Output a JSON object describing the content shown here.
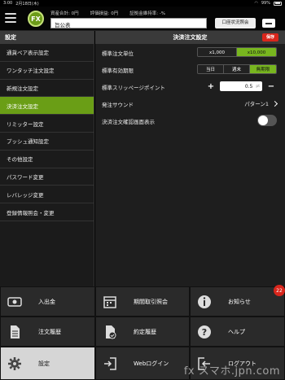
{
  "status_bar": {
    "time": "3:00",
    "date": "2月18日(木)",
    "battery": "99%"
  },
  "header": {
    "logo": "FX",
    "total_assets_label": "資産合計: 0円",
    "valuation_label": "評価損益: 0円",
    "margin_ratio_label": "証拠金維持率: -%",
    "account_name": "旨公表",
    "account_status_button": "口座状況照会"
  },
  "sidebar": {
    "title": "設定",
    "items": [
      {
        "label": "通貨ペア表示設定"
      },
      {
        "label": "ワンタッチ注文設定"
      },
      {
        "label": "新規注文設定"
      },
      {
        "label": "決済注文設定"
      },
      {
        "label": "リミッター設定"
      },
      {
        "label": "プッシュ通知設定"
      },
      {
        "label": "その他設定"
      },
      {
        "label": "パスワード変更"
      },
      {
        "label": "レバレッジ変更"
      },
      {
        "label": "登録情報照会・変更"
      }
    ]
  },
  "panel": {
    "title": "決済注文設定",
    "save_label": "保存",
    "rows": {
      "unit": {
        "label": "標準注文単位",
        "options": [
          "x1,000",
          "x10,000"
        ]
      },
      "expiry": {
        "label": "標準有効期限",
        "options": [
          "当日",
          "週末",
          "無期限"
        ]
      },
      "slippage": {
        "label": "標準スリッページポイント",
        "value": "0.5",
        "unit": "pt"
      },
      "sound": {
        "label": "発注サウンド",
        "value": "パターン1"
      },
      "confirm": {
        "label": "決済注文確認画面表示"
      }
    }
  },
  "grid": {
    "deposit": "入出金",
    "period_history": "期間取引照会",
    "news": "お知らせ",
    "news_badge": "22",
    "order_history": "注文履歴",
    "execution_history": "約定履歴",
    "help": "ヘルプ",
    "settings": "設定",
    "web_login": "Webログイン",
    "logout": "ログアウト"
  },
  "watermark": "fx スマホ.jpn.com",
  "colors": {
    "accent": "#6a9e16",
    "selected": "#78b61f",
    "danger": "#d9261c"
  }
}
